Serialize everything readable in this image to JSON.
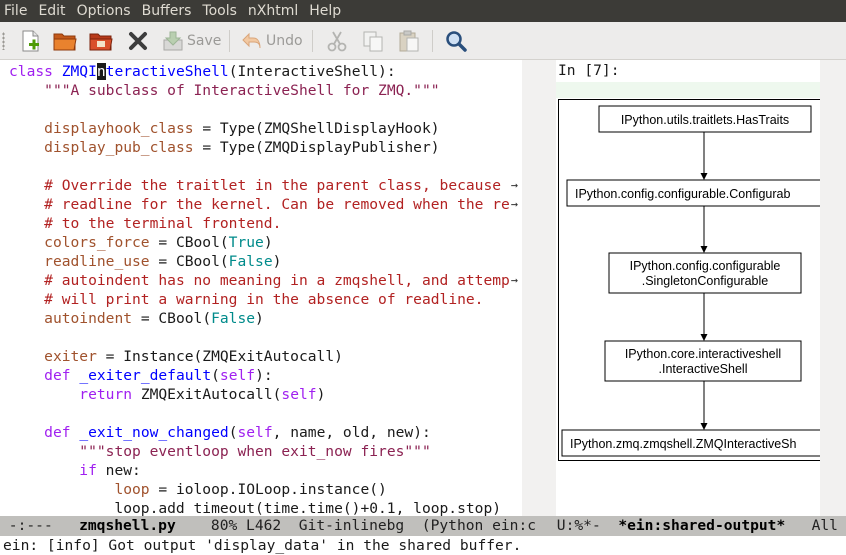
{
  "menu": [
    "File",
    "Edit",
    "Options",
    "Buffers",
    "Tools",
    "nXhtml",
    "Help"
  ],
  "toolbar": {
    "save_label": "Save",
    "undo_label": "Undo",
    "icons": [
      "new-file-icon",
      "open-folder-icon",
      "dired-icon",
      "close-buffer-icon",
      "save-icon",
      "undo-icon",
      "cut-icon",
      "copy-icon",
      "paste-icon",
      "search-icon"
    ]
  },
  "code": {
    "lines": [
      [
        {
          "t": "class ",
          "c": "kw"
        },
        {
          "t": "ZMQI",
          "c": "fn"
        },
        {
          "t": "n",
          "c": "cursor"
        },
        {
          "t": "teractiveShell",
          "c": "fn"
        },
        {
          "t": "(InteractiveShell):",
          "c": ""
        }
      ],
      [
        {
          "t": "    ",
          "c": ""
        },
        {
          "t": "\"\"\"A subclass of InteractiveShell for ZMQ.\"\"\"",
          "c": "st"
        }
      ],
      [],
      [
        {
          "t": "    ",
          "c": ""
        },
        {
          "t": "displayhook_class",
          "c": "vr"
        },
        {
          "t": " = Type(ZMQShellDisplayHook)",
          "c": ""
        }
      ],
      [
        {
          "t": "    ",
          "c": ""
        },
        {
          "t": "display_pub_class",
          "c": "vr"
        },
        {
          "t": " = Type(ZMQDisplayPublisher)",
          "c": ""
        }
      ],
      [],
      [
        {
          "t": "    ",
          "c": ""
        },
        {
          "t": "# Override the traitlet in the parent class, because",
          "c": "cm"
        }
      ],
      [
        {
          "t": "    ",
          "c": ""
        },
        {
          "t": "# readline for the kernel. Can be removed when the re",
          "c": "cm"
        }
      ],
      [
        {
          "t": "    ",
          "c": ""
        },
        {
          "t": "# to the terminal frontend.",
          "c": "cm"
        }
      ],
      [
        {
          "t": "    ",
          "c": ""
        },
        {
          "t": "colors_force",
          "c": "vr"
        },
        {
          "t": " = CBool(",
          "c": ""
        },
        {
          "t": "True",
          "c": "co"
        },
        {
          "t": ")",
          "c": ""
        }
      ],
      [
        {
          "t": "    ",
          "c": ""
        },
        {
          "t": "readline_use",
          "c": "vr"
        },
        {
          "t": " = CBool(",
          "c": ""
        },
        {
          "t": "False",
          "c": "co"
        },
        {
          "t": ")",
          "c": ""
        }
      ],
      [
        {
          "t": "    ",
          "c": ""
        },
        {
          "t": "# autoindent has no meaning in a zmqshell, and attemp",
          "c": "cm"
        }
      ],
      [
        {
          "t": "    ",
          "c": ""
        },
        {
          "t": "# will print a warning in the absence of readline.",
          "c": "cm"
        }
      ],
      [
        {
          "t": "    ",
          "c": ""
        },
        {
          "t": "autoindent",
          "c": "vr"
        },
        {
          "t": " = CBool(",
          "c": ""
        },
        {
          "t": "False",
          "c": "co"
        },
        {
          "t": ")",
          "c": ""
        }
      ],
      [],
      [
        {
          "t": "    ",
          "c": ""
        },
        {
          "t": "exiter",
          "c": "vr"
        },
        {
          "t": " = Instance(ZMQExitAutocall)",
          "c": ""
        }
      ],
      [
        {
          "t": "    ",
          "c": ""
        },
        {
          "t": "def ",
          "c": "kw"
        },
        {
          "t": "_exiter_default",
          "c": "fn"
        },
        {
          "t": "(",
          "c": ""
        },
        {
          "t": "self",
          "c": "kw"
        },
        {
          "t": "):",
          "c": ""
        }
      ],
      [
        {
          "t": "        ",
          "c": ""
        },
        {
          "t": "return ",
          "c": "kw"
        },
        {
          "t": "ZMQExitAutocall(",
          "c": ""
        },
        {
          "t": "self",
          "c": "kw"
        },
        {
          "t": ")",
          "c": ""
        }
      ],
      [],
      [
        {
          "t": "    ",
          "c": ""
        },
        {
          "t": "def ",
          "c": "kw"
        },
        {
          "t": "_exit_now_changed",
          "c": "fn"
        },
        {
          "t": "(",
          "c": ""
        },
        {
          "t": "self",
          "c": "kw"
        },
        {
          "t": ", name, old, new):",
          "c": ""
        }
      ],
      [
        {
          "t": "        ",
          "c": ""
        },
        {
          "t": "\"\"\"stop eventloop when exit_now fires\"\"\"",
          "c": "st"
        }
      ],
      [
        {
          "t": "        ",
          "c": ""
        },
        {
          "t": "if ",
          "c": "kw"
        },
        {
          "t": "new:",
          "c": ""
        }
      ],
      [
        {
          "t": "            ",
          "c": ""
        },
        {
          "t": "loop",
          "c": "vr"
        },
        {
          "t": " = ioloop.IOLoop.instance()",
          "c": ""
        }
      ],
      [
        {
          "t": "            loop.add_timeout(time.time()+0.1, loop.stop)",
          "c": ""
        }
      ]
    ],
    "truncated_lines": [
      6,
      7,
      11
    ]
  },
  "notebook": {
    "prompt": "In [7]:",
    "diagram_nodes": [
      [
        "IPython.utils.traitlets.HasTraits"
      ],
      [
        "IPython.config.configurable.Configurab"
      ],
      [
        "IPython.config.configurable",
        ".SingletonConfigurable"
      ],
      [
        "IPython.core.interactiveshell",
        ".InteractiveShell"
      ],
      [
        "IPython.zmq.zmqshell.ZMQInteractiveSh"
      ]
    ]
  },
  "modeline_left": {
    "status": "-:---",
    "buffer": "zmqshell.py",
    "position": "80% L462",
    "vc": "Git-inlinebg",
    "modes": "(Python ein:c"
  },
  "modeline_right": {
    "status": "U:%*-",
    "buffer": "*ein:shared-output*",
    "position": "All"
  },
  "echo": "ein: [info] Got output 'display_data' in the shared buffer.",
  "colors": {
    "menubar": "#3c3b37",
    "keyword": "#a020f0",
    "function": "#0000ff",
    "variable": "#a0522d",
    "string": "#8b2252",
    "comment": "#b22222",
    "constant": "#008b8b",
    "modeline": "#c0bfbc"
  }
}
